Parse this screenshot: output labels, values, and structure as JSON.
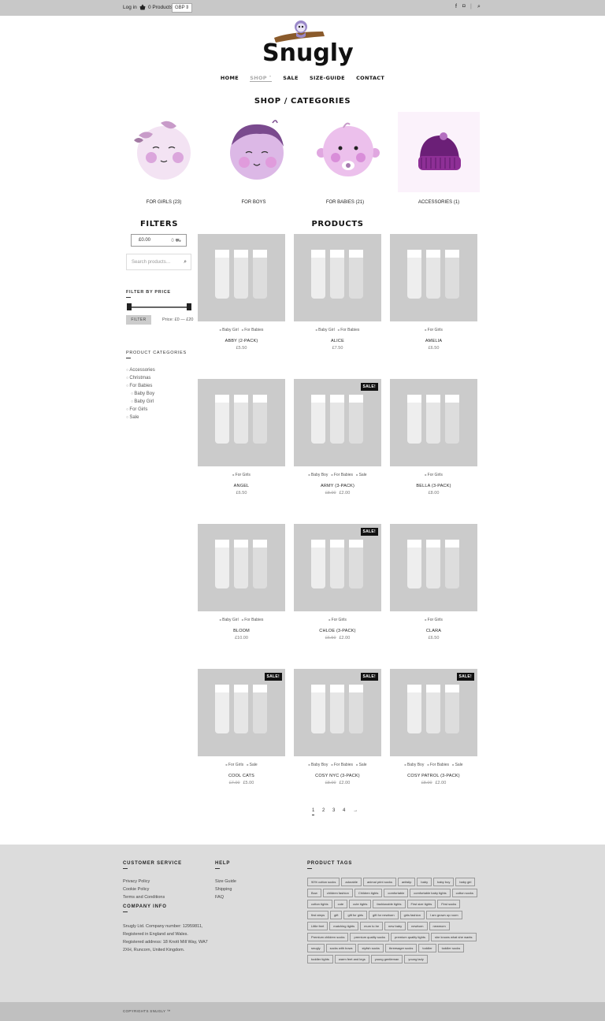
{
  "topbar": {
    "login": "Log in",
    "cart_count": "0 Products",
    "currency": "GBP"
  },
  "brand": {
    "name": "Snugly"
  },
  "nav": {
    "items": [
      "HOME",
      "SHOP",
      "SALE",
      "SIZE-GUIDE",
      "CONTACT"
    ],
    "active": "SHOP"
  },
  "categories_title": "SHOP / CATEGORIES",
  "categories": [
    {
      "label": "FOR GIRLS (23)"
    },
    {
      "label": "FOR BOYS"
    },
    {
      "label": "FOR BABIES (21)"
    },
    {
      "label": "ACCESSORIES (1)"
    }
  ],
  "sidebar": {
    "title": "FILTERS",
    "cart_amount": "£0.00",
    "cart_items": "0",
    "search_placeholder": "Search products…",
    "price_filter_title": "FILTER BY PRICE",
    "filter_button": "FILTER",
    "price_range": "Price: £0 — £20",
    "categories_title": "PRODUCT CATEGORIES",
    "category_list": [
      "Accessories",
      "Christmas",
      "For Babies",
      "Baby Boy",
      "Baby Girl",
      "For Girls",
      "Sale"
    ]
  },
  "products_title": "PRODUCTS",
  "products": [
    {
      "name": "ABBY (2-PACK)",
      "tags": [
        "Baby Girl",
        "For Babies"
      ],
      "price": "£5.50",
      "old_price": "",
      "sale": false
    },
    {
      "name": "ALICE",
      "tags": [
        "Baby Girl",
        "For Babies"
      ],
      "price": "£7.50",
      "old_price": "",
      "sale": false
    },
    {
      "name": "AMELIA",
      "tags": [
        "For Girls"
      ],
      "price": "£6.50",
      "old_price": "",
      "sale": false
    },
    {
      "name": "ANGEL",
      "tags": [
        "For Girls"
      ],
      "price": "£6.50",
      "old_price": "",
      "sale": false
    },
    {
      "name": "ARMY (3-PACK)",
      "tags": [
        "Baby Boy",
        "For Babies",
        "Sale"
      ],
      "price": "£2.00",
      "old_price": "£8.00",
      "sale": true
    },
    {
      "name": "BELLA (3-PACK)",
      "tags": [
        "For Girls"
      ],
      "price": "£8.00",
      "old_price": "",
      "sale": false
    },
    {
      "name": "BLOOM",
      "tags": [
        "Baby Girl",
        "For Babies"
      ],
      "price": "£10.00",
      "old_price": "",
      "sale": false
    },
    {
      "name": "CHLOE (3-PACK)",
      "tags": [
        "For Girls"
      ],
      "price": "£2.00",
      "old_price": "£6.50",
      "sale": true
    },
    {
      "name": "CLARA",
      "tags": [
        "For Girls"
      ],
      "price": "£6.50",
      "old_price": "",
      "sale": false
    },
    {
      "name": "COOL CATS",
      "tags": [
        "For Girls",
        "Sale"
      ],
      "price": "£5.00",
      "old_price": "£7.00",
      "sale": true
    },
    {
      "name": "COSY NYC (3-PACK)",
      "tags": [
        "Baby Boy",
        "For Babies",
        "Sale"
      ],
      "price": "£2.00",
      "old_price": "£8.00",
      "sale": true
    },
    {
      "name": "COSY PATROL (3-PACK)",
      "tags": [
        "Baby Boy",
        "For Babies",
        "Sale"
      ],
      "price": "£2.00",
      "old_price": "£8.00",
      "sale": true
    }
  ],
  "sale_badge": "SALE!",
  "pagination": [
    "1",
    "2",
    "3",
    "4",
    "→"
  ],
  "footer": {
    "customer_service": {
      "title": "CUSTOMER SERVICE",
      "links": [
        "Privacy Policy",
        "Cookie Policy",
        "Terms and Conditions"
      ]
    },
    "help": {
      "title": "HELP",
      "links": [
        "Size Guide",
        "Shipping",
        "FAQ"
      ]
    },
    "company": {
      "title": "COMPANY INFO",
      "text": "Snugly Ltd. Company number: 12959811, Registered in England and Wales. Registered address: 18 Knott Mill Way, WA7 2XH, Runcorn, United Kingdom."
    },
    "tags_title": "PRODUCT TAGS",
    "tags": [
      "90% cotton socks",
      "adorable",
      "animal print socks",
      "antislip",
      "baby",
      "baby boy",
      "baby girl",
      "Bow",
      "children fashion",
      "Children tights",
      "comfortable",
      "comfortable baby tights",
      "cotton socks",
      "cotton tights",
      "cute",
      "cute tights",
      "fashionable tights",
      "First size tights",
      "First socks",
      "first steps",
      "gift",
      "gift for girls",
      "gift for newborn",
      "girls fashion",
      "I am grown up room",
      "Little feet",
      "matching tights",
      "mum to be",
      "new baby",
      "newborn",
      "newmom",
      "Premium children socks",
      "premium quality socks",
      "premium quality tights",
      "she knows what she wants",
      "snugly",
      "socks with bows",
      "stylish socks",
      "threesager socks",
      "toddler",
      "toddler socks",
      "toddler tights",
      "warm feet and legs",
      "young gentleman",
      "young lady"
    ],
    "copyright": "COPYRIGHTS SNUGLY ™"
  }
}
